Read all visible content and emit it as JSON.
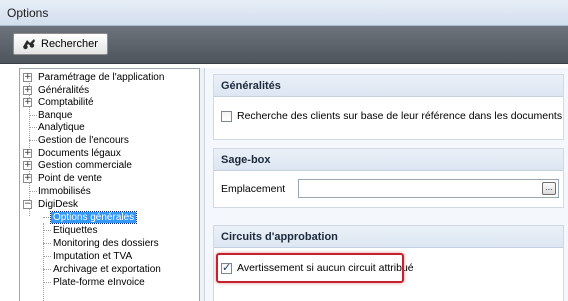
{
  "window": {
    "title": "Options"
  },
  "toolbar": {
    "search_label": "Rechercher",
    "search_icon": "binoculars-icon"
  },
  "tree": {
    "items": [
      {
        "label": "Paramétrage de l'application",
        "expander": "+"
      },
      {
        "label": "Généralités",
        "expander": "+"
      },
      {
        "label": "Comptabilité",
        "expander": "+"
      },
      {
        "label": "Banque",
        "expander": ""
      },
      {
        "label": "Analytique",
        "expander": ""
      },
      {
        "label": "Gestion de l'encours",
        "expander": ""
      },
      {
        "label": "Documents légaux",
        "expander": "+"
      },
      {
        "label": "Gestion commerciale",
        "expander": "+"
      },
      {
        "label": "Point de vente",
        "expander": "+"
      },
      {
        "label": "Immobilisés",
        "expander": ""
      },
      {
        "label": "DigiDesk",
        "expander": "−"
      },
      {
        "label": "Options générales",
        "expander": "",
        "selected": true
      },
      {
        "label": "Etiquettes",
        "expander": ""
      },
      {
        "label": "Monitoring des dossiers",
        "expander": ""
      },
      {
        "label": "Imputation et TVA",
        "expander": ""
      },
      {
        "label": "Archivage et exportation",
        "expander": ""
      },
      {
        "label": "Plate-forme eInvoice",
        "expander": ""
      }
    ]
  },
  "panels": {
    "generalites": {
      "header": "Généralités",
      "checkbox_label": "Recherche des clients sur base de leur référence dans les documents",
      "checked": false
    },
    "sagebox": {
      "header": "Sage-box",
      "field_label": "Emplacement",
      "field_value": "",
      "button_label": "..."
    },
    "circuits": {
      "header": "Circuits d'approbation",
      "checkbox_label": "Avertissement si aucun circuit attribué",
      "checked": true
    }
  },
  "colors": {
    "highlight": "#c3232e",
    "selection": "#3399ff",
    "toolbar": "#5d646c"
  }
}
